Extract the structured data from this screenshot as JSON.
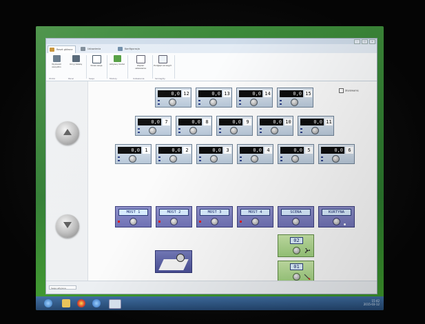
{
  "window": {
    "title": "",
    "tabs": [
      {
        "label": "Reset główne",
        "active": true
      },
      {
        "label": "Ustawienia",
        "active": false
      },
      {
        "label": "Konfiguracja",
        "active": false
      }
    ]
  },
  "ribbon": {
    "buttons": [
      {
        "label": "Wyświetl wszystko"
      },
      {
        "label": "Ukryj tabelę"
      },
      {
        "label": "Nowa sesja"
      },
      {
        "label": "Aktywuj moduł"
      },
      {
        "label": "Zapisz ustawienia"
      },
      {
        "label": "Podgląd szczegół"
      }
    ],
    "groups": [
      "Widok",
      "Panel",
      "Sesja",
      "Moduły",
      "Ustawienia",
      "Szczegóły"
    ]
  },
  "main": {
    "checkbox_label": "Sterowanie",
    "row1": [
      {
        "value": "0,0",
        "num": "12"
      },
      {
        "value": "0,0",
        "num": "13"
      },
      {
        "value": "0,0",
        "num": "14"
      },
      {
        "value": "0,0",
        "num": "15"
      }
    ],
    "row2": [
      {
        "value": "0,0",
        "num": "7"
      },
      {
        "value": "0,0",
        "num": "8"
      },
      {
        "value": "0,0",
        "num": "9"
      },
      {
        "value": "0,0",
        "num": "10"
      },
      {
        "value": "0,0",
        "num": "11"
      }
    ],
    "row3": [
      {
        "value": "0,0",
        "num": "1"
      },
      {
        "value": "0,0",
        "num": "2"
      },
      {
        "value": "0,0",
        "num": "3"
      },
      {
        "value": "0,0",
        "num": "4"
      },
      {
        "value": "0,0",
        "num": "5"
      },
      {
        "value": "0,0",
        "num": "6"
      }
    ],
    "purple": [
      "MOST 1",
      "MOST 2",
      "MOST 3",
      "MOST 4",
      "SCENA",
      "KURTYNA"
    ],
    "green": [
      {
        "value": "02",
        "icon": "fan-icon"
      },
      {
        "value": "01",
        "icon": "brush-icon"
      }
    ]
  },
  "status": {
    "field_text": "Sesja aktywna"
  },
  "tray": {
    "time": "15:42",
    "date": "2015-03-12"
  }
}
